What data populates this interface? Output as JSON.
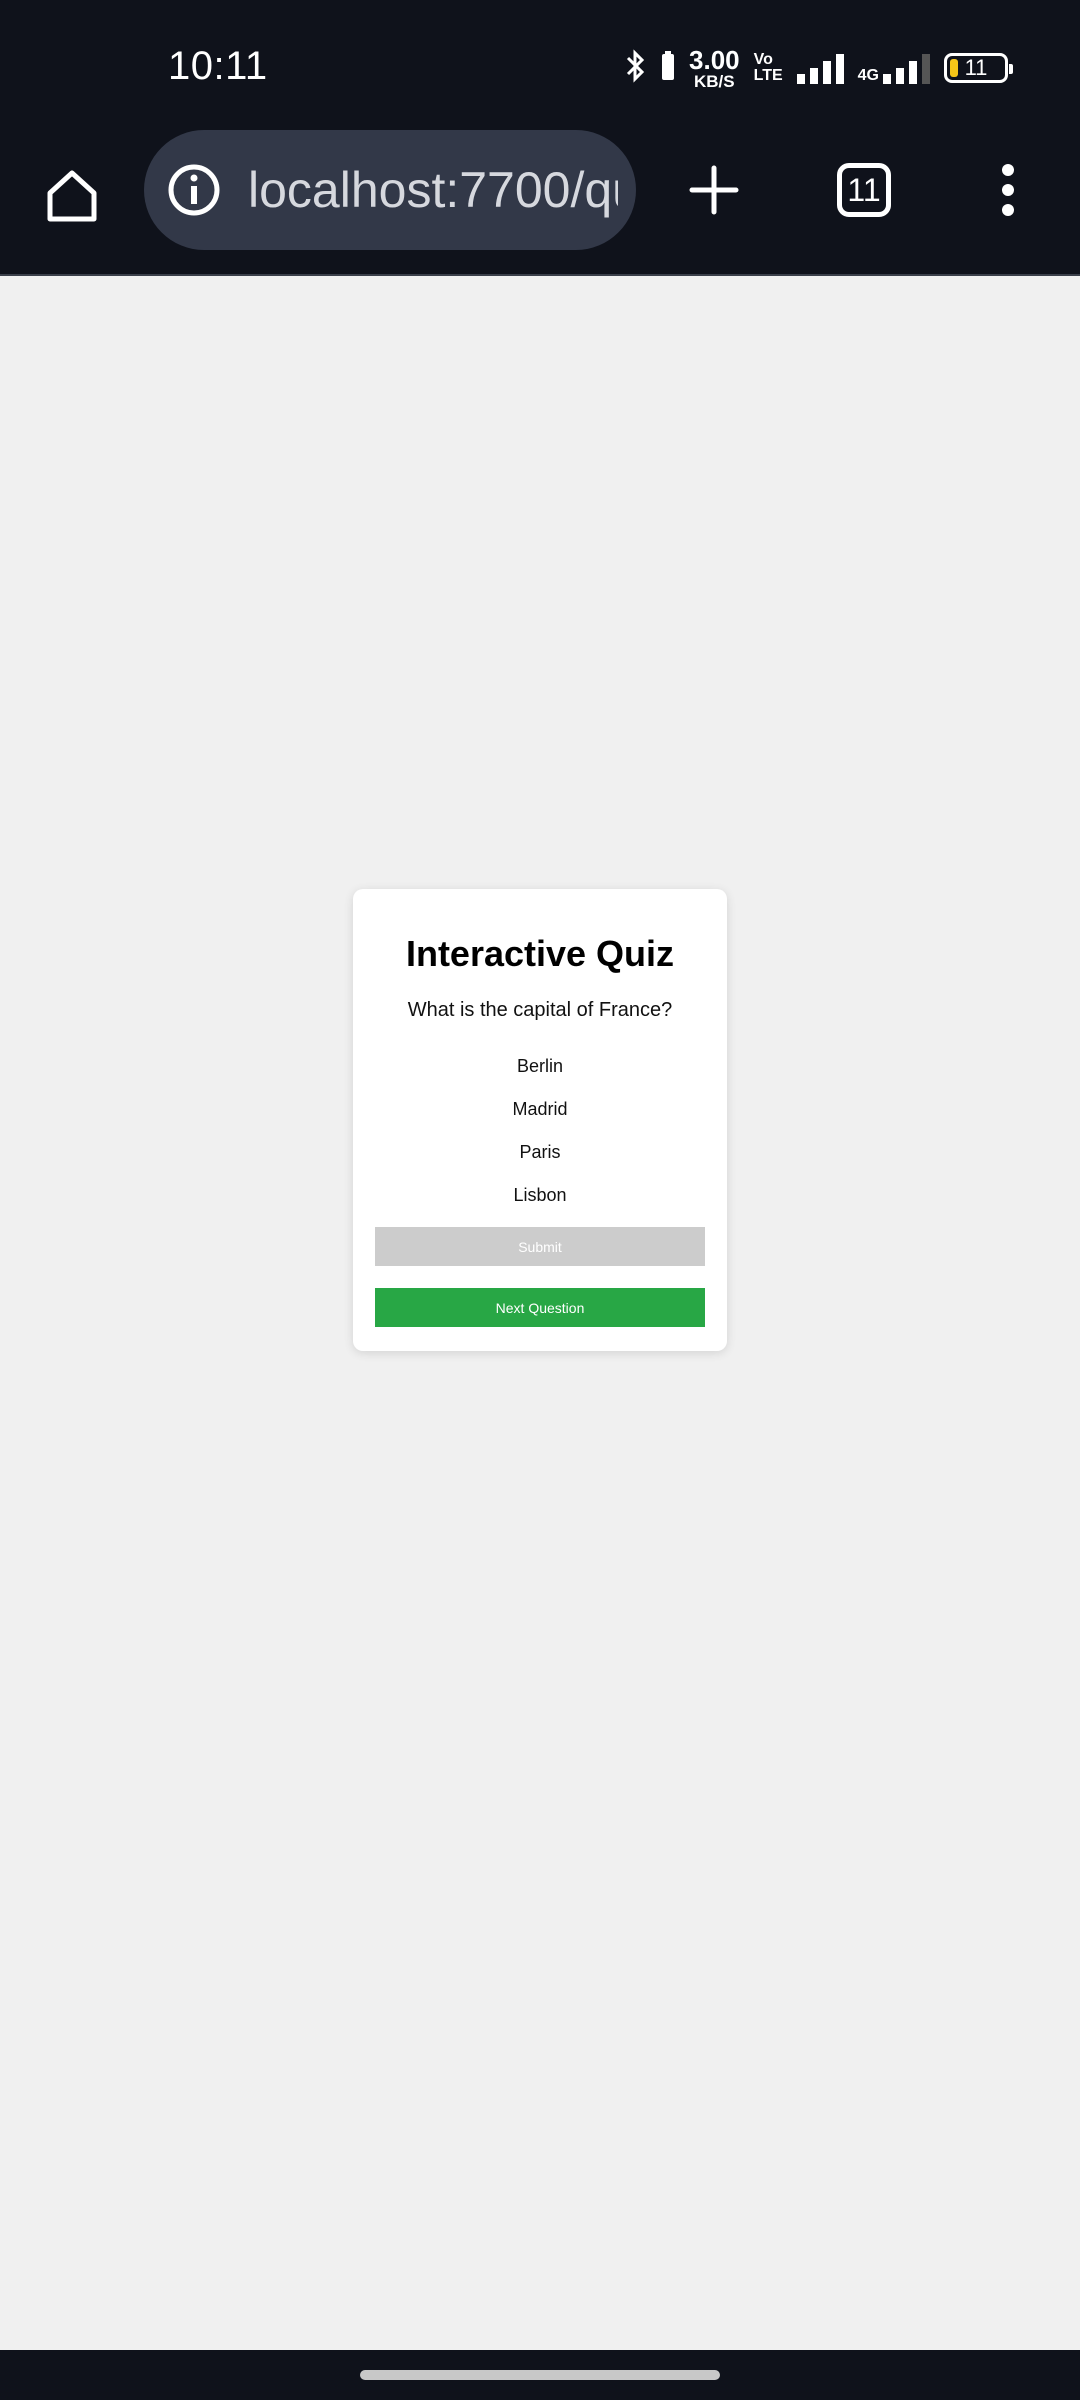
{
  "status_bar": {
    "time": "10:11",
    "net_speed_value": "3.00",
    "net_speed_unit": "KB/S",
    "volte_top": "Vo",
    "volte_bottom": "LTE",
    "network_type": "4G",
    "battery_level": "11",
    "icons": [
      "bluetooth-icon",
      "signal-icon",
      "signal-4g-icon",
      "battery-icon"
    ]
  },
  "browser": {
    "url": "localhost:7700/qu",
    "tab_count": "11",
    "icons": [
      "home-icon",
      "info-icon",
      "plus-icon",
      "tabs-icon",
      "menu-icon"
    ],
    "colors": {
      "toolbar_bg": "#0f121b",
      "url_bar_bg": "#323848"
    }
  },
  "quiz": {
    "title": "Interactive Quiz",
    "question": "What is the capital of France?",
    "options": [
      "Berlin",
      "Madrid",
      "Paris",
      "Lisbon"
    ],
    "submit_label": "Submit",
    "next_label": "Next Question",
    "colors": {
      "submit_bg": "#cccccc",
      "next_bg": "#28a745",
      "page_bg": "#f0f0f0"
    }
  }
}
